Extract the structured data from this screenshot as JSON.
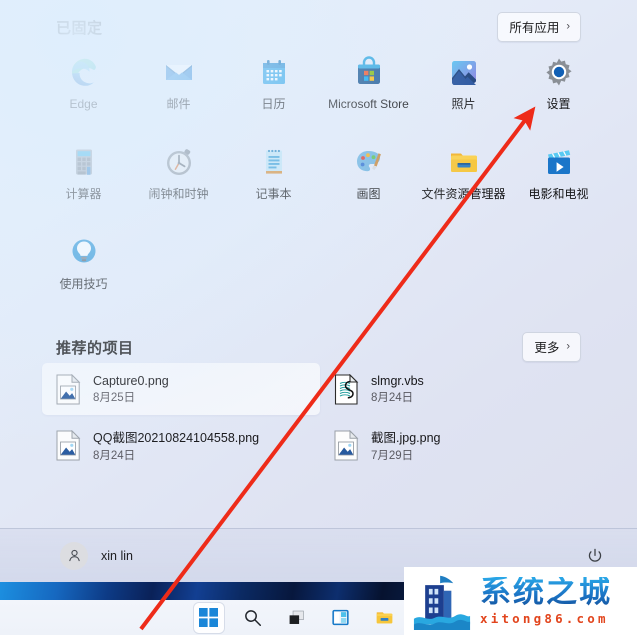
{
  "start_menu": {
    "pinned": {
      "title": "已固定",
      "all_apps_label": "所有应用",
      "all_apps_chevron": "chevron-right-icon",
      "apps": [
        {
          "label": "Edge",
          "icon": "edge-icon"
        },
        {
          "label": "邮件",
          "icon": "mail-icon"
        },
        {
          "label": "日历",
          "icon": "calendar-icon"
        },
        {
          "label": "Microsoft Store",
          "icon": "microsoft-store-icon"
        },
        {
          "label": "照片",
          "icon": "photos-icon"
        },
        {
          "label": "设置",
          "icon": "settings-gear-icon"
        },
        {
          "label": "计算器",
          "icon": "calculator-icon"
        },
        {
          "label": "闹钟和时钟",
          "icon": "alarms-clock-icon"
        },
        {
          "label": "记事本",
          "icon": "notepad-icon"
        },
        {
          "label": "画图",
          "icon": "paint-palette-icon"
        },
        {
          "label": "文件资源管理器",
          "icon": "file-explorer-folder-icon"
        },
        {
          "label": "电影和电视",
          "icon": "movies-tv-icon"
        },
        {
          "label": "使用技巧",
          "icon": "tips-lightbulb-icon"
        }
      ]
    },
    "recommended": {
      "title": "推荐的项目",
      "more_label": "更多",
      "more_chevron": "chevron-right-icon",
      "items": [
        {
          "name": "Capture0.png",
          "date": "8月25日",
          "icon": "png-image-file-icon",
          "hovered": true
        },
        {
          "name": "slmgr.vbs",
          "date": "8月24日",
          "icon": "vbs-script-file-icon",
          "hovered": false
        },
        {
          "name": "QQ截图20210824104558.png",
          "date": "8月24日",
          "icon": "png-image-file-icon",
          "hovered": false
        },
        {
          "name": "截图.jpg.png",
          "date": "7月29日",
          "icon": "png-image-file-icon",
          "hovered": false
        }
      ]
    },
    "footer": {
      "user_name": "xin lin",
      "avatar_icon": "user-avatar-icon",
      "power_icon": "power-icon"
    }
  },
  "taskbar": {
    "buttons": [
      {
        "name": "start-button",
        "icon": "windows-logo-icon",
        "active": true
      },
      {
        "name": "search-button",
        "icon": "search-icon",
        "active": false
      },
      {
        "name": "task-view-button",
        "icon": "task-view-icon",
        "active": false
      },
      {
        "name": "widgets-button",
        "icon": "widgets-icon",
        "active": false
      },
      {
        "name": "file-explorer-button",
        "icon": "folder-icon",
        "active": false
      },
      {
        "name": "edge-button",
        "icon": "edge-icon",
        "active": false
      }
    ]
  },
  "annotation": {
    "arrow_color": "#ee2b19",
    "arrow_from": "start-button",
    "arrow_to": "settings-app-tile"
  },
  "watermark": {
    "brand_cn": "系统之城",
    "brand_url": "xitong86.com",
    "logo_icon": "building-wave-logo-icon"
  },
  "colors": {
    "accent": "#0a66c2",
    "menu_bg": "#e6ecf8",
    "taskbar_bg": "#f0f4fa"
  }
}
